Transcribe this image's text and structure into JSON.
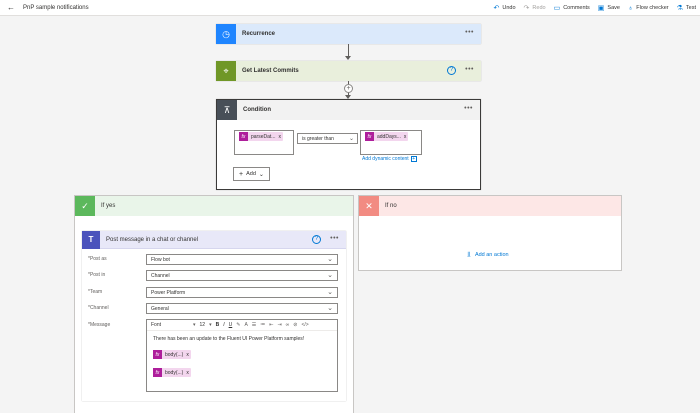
{
  "header": {
    "back_icon": "arrow-left-icon",
    "title": "PnP sample notifications",
    "commands": [
      {
        "label": "Undo",
        "icon": "undo-icon",
        "glyph": "↶",
        "enabled": true
      },
      {
        "label": "Redo",
        "icon": "redo-icon",
        "glyph": "↷",
        "enabled": false
      },
      {
        "label": "Comments",
        "icon": "comment-icon",
        "glyph": "▭",
        "enabled": true
      },
      {
        "label": "Save",
        "icon": "save-icon",
        "glyph": "▣",
        "enabled": true
      },
      {
        "label": "Flow checker",
        "icon": "stethoscope-icon",
        "glyph": "♁",
        "enabled": true
      },
      {
        "label": "Test",
        "icon": "flask-icon",
        "glyph": "⚗",
        "enabled": true
      }
    ]
  },
  "steps": {
    "recurrence": {
      "title": "Recurrence",
      "icon": "clock-icon",
      "color": "#1f85ff"
    },
    "commits": {
      "title": "Get Latest Commits",
      "icon": "globe-icon",
      "color": "#709727"
    },
    "condition": {
      "title": "Condition",
      "icon": "condition-icon",
      "color": "#484f58"
    }
  },
  "condition": {
    "left_token": "parseDat...",
    "operator": "is greater than",
    "right_token": "addDays...",
    "dynamic_content_label": "Add dynamic content",
    "add_label": "Add"
  },
  "branches": {
    "yes": {
      "title": "If yes",
      "color": "#5cb85c"
    },
    "no": {
      "title": "If no",
      "color": "#f28b82",
      "add_action_label": "Add an action"
    }
  },
  "teams_action": {
    "title": "Post message in a chat or channel",
    "fields": [
      {
        "label": "*Post as",
        "value": "Flow bot"
      },
      {
        "label": "*Post in",
        "value": "Channel"
      },
      {
        "label": "*Team",
        "value": "Power Platform"
      },
      {
        "label": "*Channel",
        "value": "General"
      }
    ],
    "message_label": "*Message",
    "toolbar": {
      "font": "Font",
      "size": "12"
    },
    "message_text": "There has been an update to the Fluent UI Power Platform samples!",
    "tokens": [
      "body(...)",
      "body(...)"
    ]
  },
  "colors": {
    "accent": "#0078d4",
    "teams": "#4b53bc",
    "token": "#ae1e9b"
  }
}
